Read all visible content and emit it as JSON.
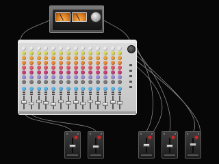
{
  "colors": {
    "background": "#070707",
    "cable": "#8a8a8a",
    "knob_rows": [
      "#e9e9e9",
      "#d8d65a",
      "#e8a13b",
      "#e88b3a",
      "#e25a6a",
      "#c8407a",
      "#9b8ad6",
      "#7a7a7a",
      "#5ab4e8"
    ],
    "record_led": "#e02020"
  },
  "rack_unit": {
    "icon": "vu-meter-compressor-icon"
  },
  "mixer": {
    "channel_count": 14,
    "fader_levels": [
      0.55,
      0.45,
      0.65,
      0.5,
      0.4,
      0.6,
      0.5,
      0.55,
      0.45,
      0.6,
      0.5,
      0.4,
      0.55,
      0.5
    ]
  },
  "units": [
    {
      "id": "unit-1",
      "fader_level": 0.5
    },
    {
      "id": "unit-2",
      "fader_level": 0.45
    },
    {
      "id": "unit-3",
      "fader_level": 0.55
    },
    {
      "id": "unit-4",
      "fader_level": 0.5
    },
    {
      "id": "unit-5",
      "fader_level": 0.6
    }
  ]
}
